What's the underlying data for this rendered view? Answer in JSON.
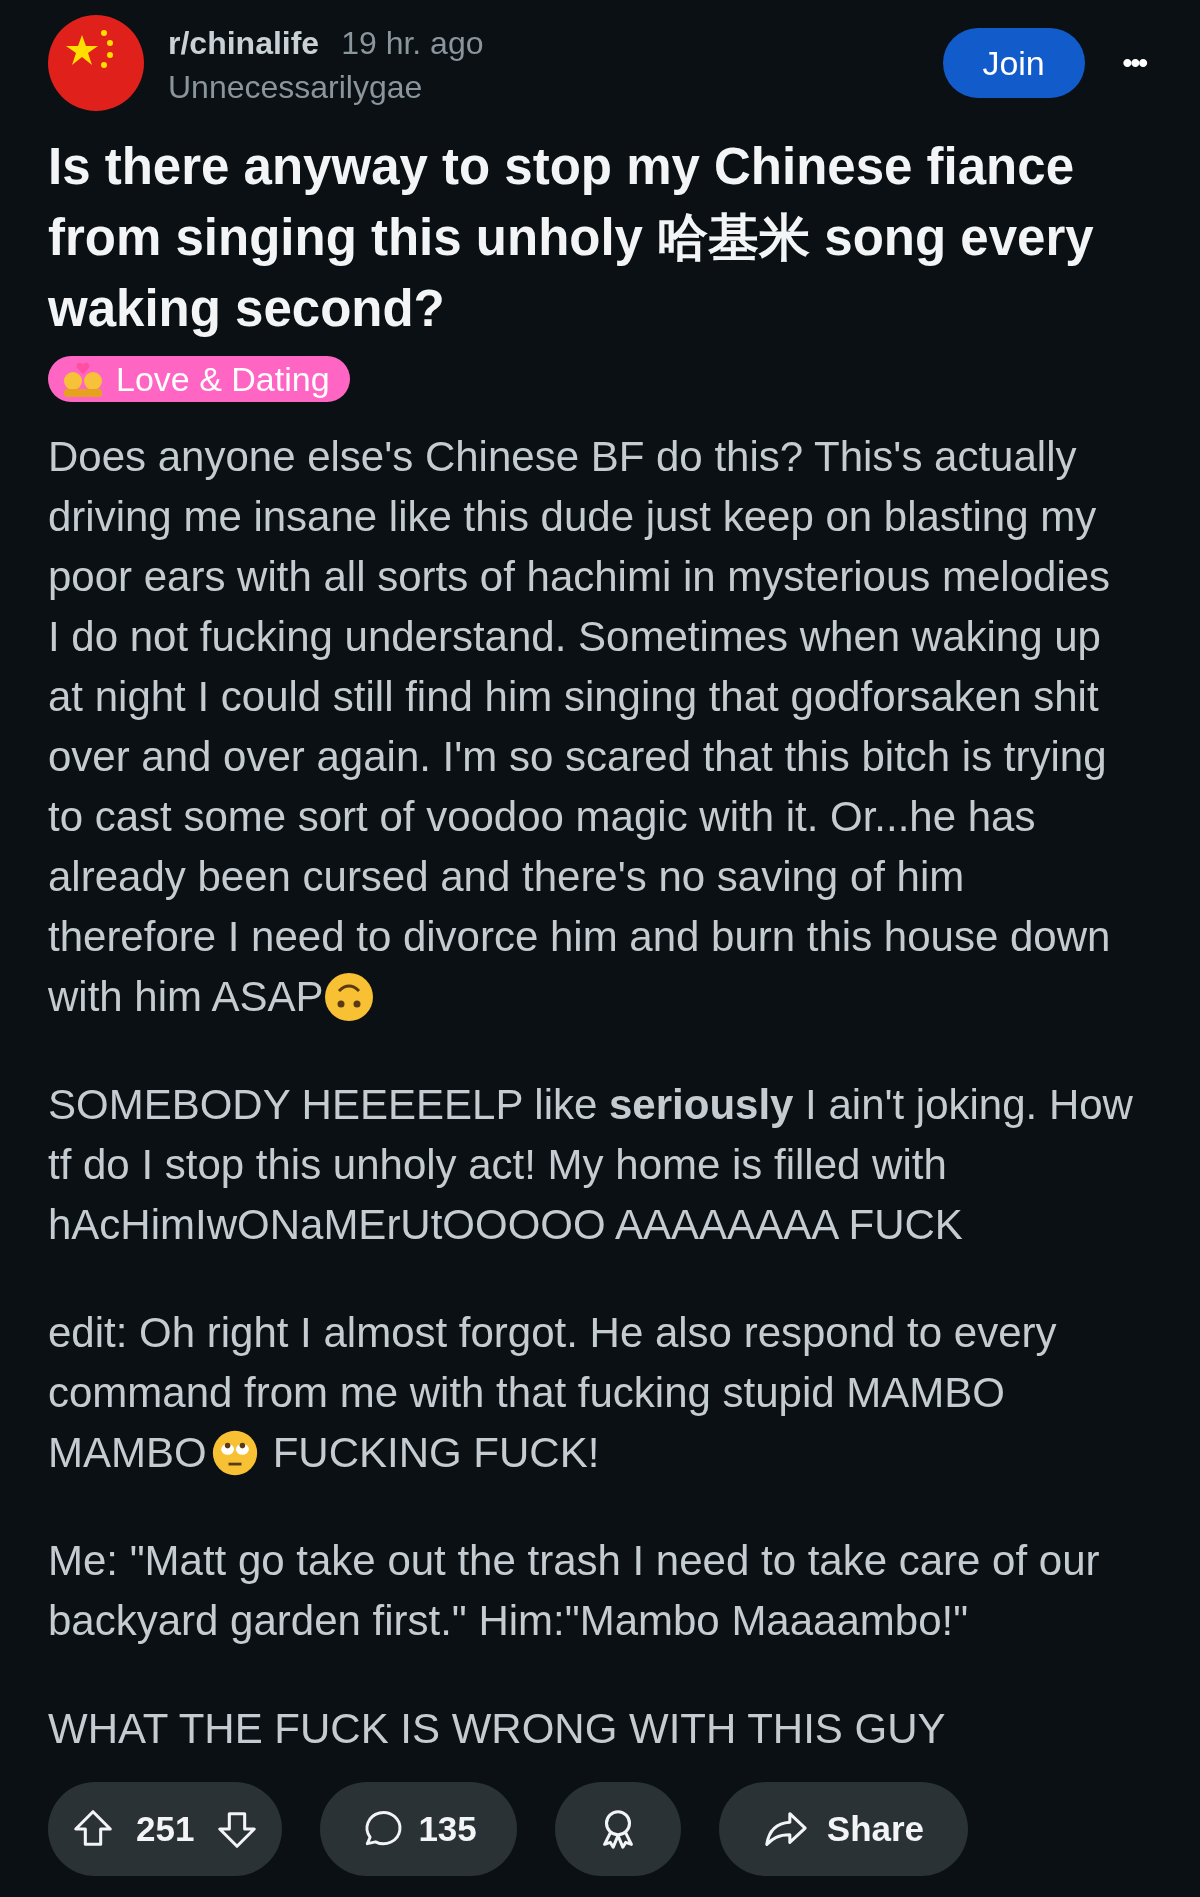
{
  "post": {
    "subreddit": "r/chinalife",
    "time": "19 hr. ago",
    "author": "Unnecessarilygae",
    "join_label": "Join",
    "more_label": "•••",
    "title": "Is there anyway to stop my Chinese fiance from singing this unholy 哈基米 song every waking second?",
    "flair": {
      "label": "Love & Dating",
      "color": "#ff66c4"
    },
    "body": [
      {
        "lines": [
          [
            {
              "kind": "text",
              "text": "Does anyone else's Chinese BF do this? This's actually"
            }
          ],
          [
            {
              "kind": "text",
              "text": "driving me insane like this dude just keep on blasting my"
            }
          ],
          [
            {
              "kind": "text",
              "text": "poor ears with all sorts of hachimi in mysterious melodies"
            }
          ],
          [
            {
              "kind": "text",
              "text": "I do not fucking understand. Sometimes when waking up"
            }
          ],
          [
            {
              "kind": "text",
              "text": "at night I could still find him singing that godforsaken shit"
            }
          ],
          [
            {
              "kind": "text",
              "text": "over and over again. I'm so scared that this bitch is trying"
            }
          ],
          [
            {
              "kind": "text",
              "text": "to cast some sort of voodoo magic with it. Or...he has"
            }
          ],
          [
            {
              "kind": "text",
              "text": "already been cursed and there's no saving of him"
            }
          ],
          [
            {
              "kind": "text",
              "text": "therefore I need to divorce him and burn this house down"
            }
          ],
          [
            {
              "kind": "text",
              "text": "with him ASAP"
            },
            {
              "kind": "upside-down-face"
            }
          ]
        ]
      },
      {
        "lines": [
          [
            {
              "kind": "text",
              "text": "SOMEBODY HEEEEELP like **seriously** I ain't joking. How"
            }
          ],
          [
            {
              "kind": "text",
              "text": "tf do I stop this unholy act! My home is filled with"
            }
          ],
          [
            {
              "kind": "text",
              "text": "hAcHimIwONaMErUtOOOOO AAAAAAAA FUCK"
            }
          ]
        ]
      },
      {
        "lines": [
          [
            {
              "kind": "text",
              "text": "edit: Oh right I almost forgot. He also respond to every"
            }
          ],
          [
            {
              "kind": "text",
              "text": "command from me with that fucking stupid MAMBO"
            }
          ],
          [
            {
              "kind": "text",
              "text": "MAMBO"
            },
            {
              "kind": "eye-roll-face"
            },
            {
              "kind": "text",
              "text": "FUCKING FUCK!"
            }
          ]
        ]
      },
      {
        "lines": [
          [
            {
              "kind": "text",
              "text": "Me: \"Matt go take out the trash I need to take care of our"
            }
          ],
          [
            {
              "kind": "text",
              "text": "backyard garden first.\" Him:\"Mambo Maaaambo!\""
            }
          ]
        ]
      },
      {
        "lines": [
          [
            {
              "kind": "text",
              "text": "WHAT THE FUCK IS WRONG WITH THIS GUY"
            }
          ]
        ]
      }
    ],
    "actions": [
      {
        "kind": "vote",
        "text": "251"
      },
      {
        "kind": "comments",
        "text": "135"
      },
      {
        "kind": "award"
      },
      {
        "kind": "share",
        "text": "Share"
      }
    ]
  }
}
